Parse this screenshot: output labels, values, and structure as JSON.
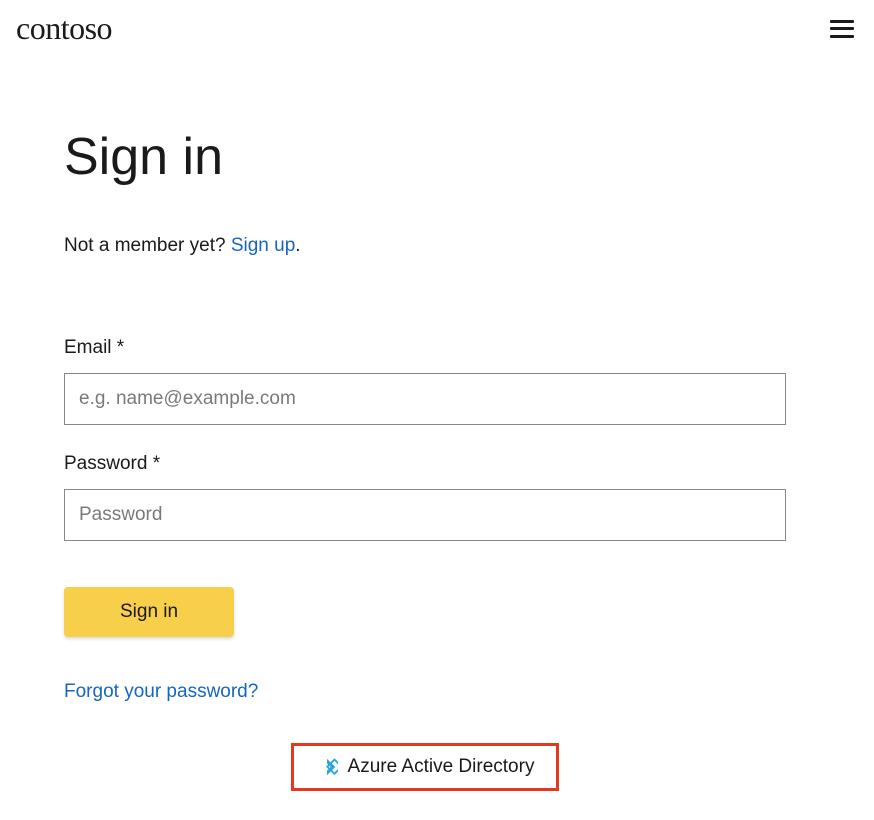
{
  "header": {
    "brand": "contoso"
  },
  "page": {
    "title": "Sign in",
    "signup_prompt": "Not a member yet? ",
    "signup_link_label": "Sign up",
    "signup_suffix": "."
  },
  "form": {
    "email_label": "Email *",
    "email_placeholder": "e.g. name@example.com",
    "email_value": "",
    "password_label": "Password *",
    "password_placeholder": "Password",
    "password_value": "",
    "submit_label": "Sign in",
    "forgot_label": "Forgot your password?"
  },
  "sso": {
    "aad_label": "Azure Active Directory",
    "aad_icon_color": "#2aa6de"
  }
}
